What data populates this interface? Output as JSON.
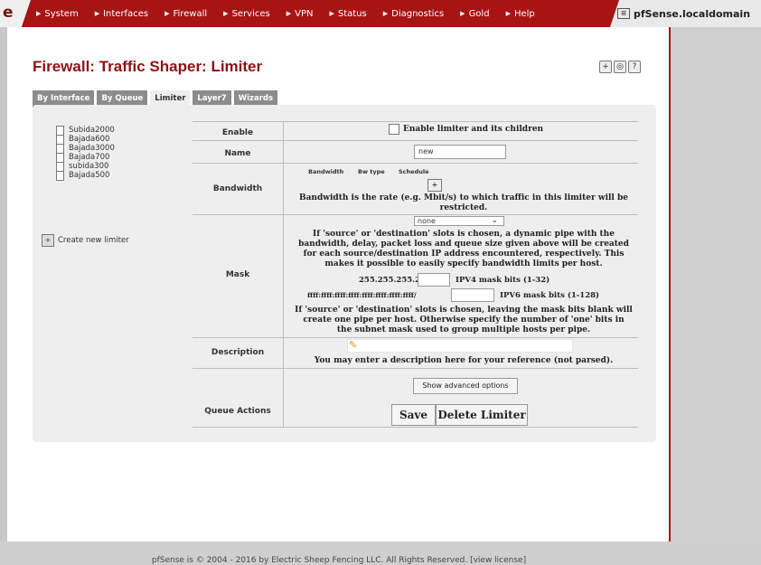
{
  "nav": {
    "brand_fragment": "e",
    "items": [
      "System",
      "Interfaces",
      "Firewall",
      "Services",
      "VPN",
      "Status",
      "Diagnostics",
      "Gold",
      "Help"
    ],
    "hostname": "pfSense.localdomain"
  },
  "page": {
    "title": "Firewall: Traffic Shaper: Limiter"
  },
  "tabs": [
    {
      "label": "By Interface",
      "active": false
    },
    {
      "label": "By Queue",
      "active": false
    },
    {
      "label": "Limiter",
      "active": true
    },
    {
      "label": "Layer7",
      "active": false
    },
    {
      "label": "Wizards",
      "active": false
    }
  ],
  "limiters": [
    "Subida2000",
    "Bajada600",
    "Bajada3000",
    "Bajada700",
    "subida300",
    "Bajada500"
  ],
  "create_link": "Create new limiter",
  "form": {
    "enable": {
      "label": "Enable",
      "checkbox_text": "Enable limiter and its children",
      "checked": false
    },
    "name": {
      "label": "Name",
      "value": "new"
    },
    "bandwidth": {
      "label": "Bandwidth",
      "col_bandwidth": "Bandwidth",
      "col_bwtype": "Bw type",
      "col_schedule": "Schedule",
      "help_line1": "Bandwidth is the rate (e.g. Mbit/s) to which traffic in this limiter will be",
      "help_line2": "restricted."
    },
    "mask": {
      "label": "Mask",
      "select_value": "none",
      "help1_line1": "If 'source' or 'destination' slots is chosen, a dynamic pipe with the",
      "help1_line2": "bandwidth, delay, packet loss and queue size given above will be created",
      "help1_line3": "for each source/destination IP address encountered, respectively. This",
      "help1_line4": "makes it possible to easily specify bandwidth limits per host.",
      "ipv4_prefix": "255.255.255.255/",
      "ipv4_hint": "IPV4 mask bits (1-32)",
      "ipv6_prefix": "ffff:ffff:ffff:ffff:ffff:ffff:ffff:ffff/",
      "ipv6_hint": "IPV6 mask bits (1-128)",
      "help2_line1": "If 'source' or 'destination' slots is chosen, leaving the mask bits blank will",
      "help2_line2": "create one pipe per host. Otherwise specify the number of 'one' bits in",
      "help2_line3": "the subnet mask used to group multiple hosts per pipe."
    },
    "description": {
      "label": "Description",
      "value": "",
      "help": "You may enter a description here for your reference (not parsed)."
    },
    "queue_actions": {
      "label": "Queue Actions",
      "advanced": "Show advanced options",
      "save": "Save",
      "delete": "Delete Limiter"
    }
  },
  "footer": {
    "text": "pfSense is © 2004 - 2016 by Electric Sheep Fencing LLC. All Rights Reserved. [",
    "link": "view license",
    "end": "]"
  }
}
